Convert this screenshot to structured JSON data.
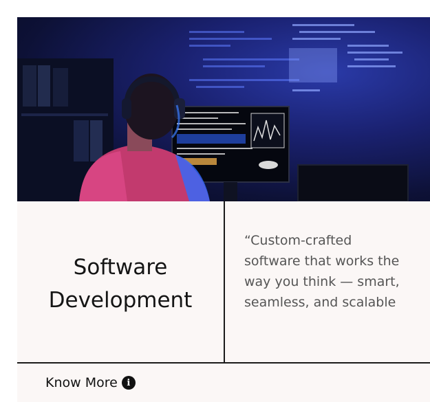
{
  "card": {
    "title_line1": "Software",
    "title_line2": "Development",
    "quote_line1": "“Custom-crafted",
    "quote_line2": "software that works the",
    "quote_line3": "way you think — smart,",
    "quote_line4": "seamless, and scalable",
    "cta_label": "Know More",
    "cta_icon": "info-icon"
  },
  "colors": {
    "panel_bg": "#fbf7f6",
    "divider": "#1a1a1a",
    "quote_text": "#555555",
    "hero_dark": "#0d1136",
    "hero_glow": "#2a3aa8"
  }
}
